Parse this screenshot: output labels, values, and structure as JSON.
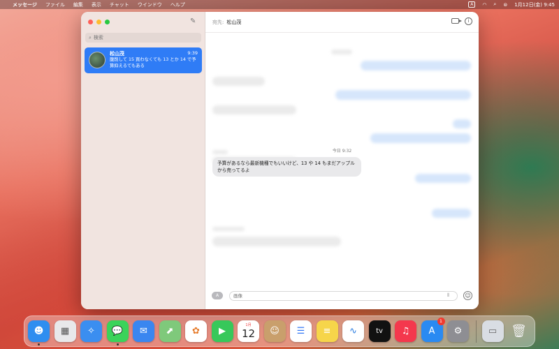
{
  "menubar": {
    "apple": "",
    "app_name": "メッセージ",
    "menus": [
      "ファイル",
      "編集",
      "表示",
      "チャット",
      "ウインドウ",
      "ヘルプ"
    ],
    "input_indicator": "A",
    "datetime": "1月12日(金) 9:45"
  },
  "sidebar": {
    "search_placeholder": "検索",
    "conversations": [
      {
        "name": "松山茂",
        "time": "9:39",
        "preview": "腹削して 15 買わなくても 13 とか 14 で予算抑えるてもある"
      }
    ]
  },
  "header": {
    "to_label": "宛先:",
    "to_name": "松山茂"
  },
  "chat": {
    "timestamp": "今日 9:32",
    "message": "予算があるなら最新機種でもいいけど、13 や 14 もまだアップルから売ってるよ"
  },
  "composer": {
    "apps_label": "A",
    "placeholder": "画像"
  },
  "dock": {
    "items": [
      {
        "name": "finder",
        "glyph": "☻",
        "bg": "#2f8ef0"
      },
      {
        "name": "launchpad",
        "glyph": "▦",
        "bg": "#e8e8ea"
      },
      {
        "name": "safari",
        "glyph": "✧",
        "bg": "#3b8ef0"
      },
      {
        "name": "messages",
        "glyph": "💬",
        "bg": "#3ad35a"
      },
      {
        "name": "mail",
        "glyph": "✉",
        "bg": "#3a86f0"
      },
      {
        "name": "maps",
        "glyph": "⬈",
        "bg": "#7fc97b"
      },
      {
        "name": "photos",
        "glyph": "✿",
        "bg": "#ffffff"
      },
      {
        "name": "facetime",
        "glyph": "▶",
        "bg": "#37c85a"
      },
      {
        "name": "calendar",
        "month": "1月",
        "day": "12"
      },
      {
        "name": "contacts",
        "glyph": "☺",
        "bg": "#c99f6c"
      },
      {
        "name": "reminders",
        "glyph": "☰",
        "bg": "#ffffff"
      },
      {
        "name": "notes",
        "glyph": "≡",
        "bg": "#f6d54a"
      },
      {
        "name": "freeform",
        "glyph": "∿",
        "bg": "#ffffff"
      },
      {
        "name": "tv",
        "glyph": "tv",
        "bg": "#111111"
      },
      {
        "name": "music",
        "glyph": "♫",
        "bg": "#f4384d"
      },
      {
        "name": "app-store",
        "glyph": "A",
        "bg": "#2a8af2",
        "badge": "1"
      },
      {
        "name": "system-settings",
        "glyph": "⚙",
        "bg": "#8e8e93"
      }
    ],
    "after_separator": [
      {
        "name": "screenshot-folder",
        "glyph": "▭",
        "bg": "#d9dde3"
      },
      {
        "name": "trash",
        "glyph": "🗑",
        "bg": "transparent"
      }
    ]
  }
}
